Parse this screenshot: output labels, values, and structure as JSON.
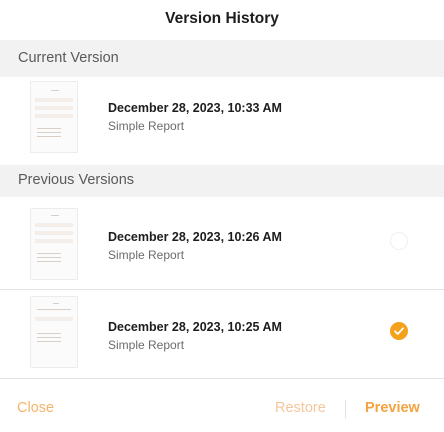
{
  "dialog": {
    "title": "Version History"
  },
  "sections": {
    "current_label": "Current Version",
    "previous_label": "Previous Versions"
  },
  "current_version": {
    "date": "December 28, 2023, 10:33 AM",
    "name": "Simple Report",
    "thumbnail_icon": "document-thumbnail-icon"
  },
  "previous_versions": [
    {
      "date": "December 28, 2023, 10:26 AM",
      "name": "Simple Report",
      "selected": false,
      "thumbnail_icon": "document-thumbnail-icon"
    },
    {
      "date": "December 28, 2023, 10:25 AM",
      "name": "Simple Report",
      "selected": true,
      "thumbnail_icon": "document-thumbnail-icon"
    }
  ],
  "footer": {
    "close_label": "Close",
    "restore_label": "Restore",
    "preview_label": "Preview"
  },
  "colors": {
    "accent": "#f4a21c",
    "accent_text": "#f4a340",
    "accent_muted": "#f5c79a",
    "section_background": "#f2f2f2"
  }
}
